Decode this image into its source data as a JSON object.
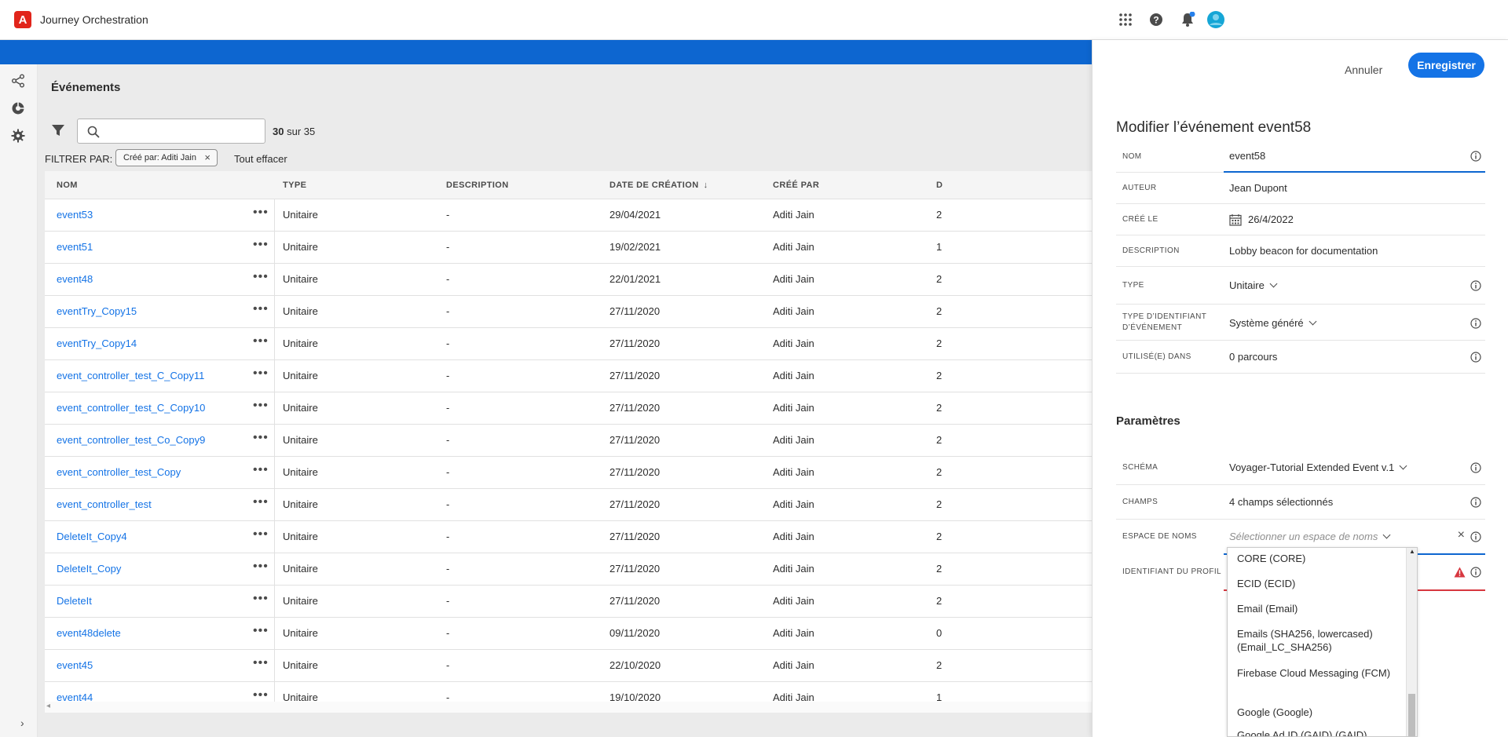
{
  "app": {
    "logo_text": "A",
    "title": "Journey Orchestration",
    "notification_count": ""
  },
  "events_list": {
    "title": "Événements",
    "search_placeholder": "",
    "count_shown": "30",
    "count_suffix": "sur 35",
    "filter_label": "FILTRER PAR:",
    "filter_chip": "Créé par: Aditi Jain",
    "clear_all": "Tout effacer",
    "columns": [
      "NOM",
      "TYPE",
      "DESCRIPTION",
      "DATE DE CRÉATION",
      "CRÉÉ PAR",
      "D"
    ],
    "rows": [
      {
        "name": "event53",
        "type": "Unitaire",
        "description": "-",
        "date": "29/04/2021",
        "creator": "Aditi Jain",
        "extra": "2"
      },
      {
        "name": "event51",
        "type": "Unitaire",
        "description": "-",
        "date": "19/02/2021",
        "creator": "Aditi Jain",
        "extra": "1"
      },
      {
        "name": "event48",
        "type": "Unitaire",
        "description": "-",
        "date": "22/01/2021",
        "creator": "Aditi Jain",
        "extra": "2"
      },
      {
        "name": "eventTry_Copy15",
        "type": "Unitaire",
        "description": "-",
        "date": "27/11/2020",
        "creator": "Aditi Jain",
        "extra": "2"
      },
      {
        "name": "eventTry_Copy14",
        "type": "Unitaire",
        "description": "-",
        "date": "27/11/2020",
        "creator": "Aditi Jain",
        "extra": "2"
      },
      {
        "name": "event_controller_test_C_Copy11",
        "type": "Unitaire",
        "description": "-",
        "date": "27/11/2020",
        "creator": "Aditi Jain",
        "extra": "2"
      },
      {
        "name": "event_controller_test_C_Copy10",
        "type": "Unitaire",
        "description": "-",
        "date": "27/11/2020",
        "creator": "Aditi Jain",
        "extra": "2"
      },
      {
        "name": "event_controller_test_Co_Copy9",
        "type": "Unitaire",
        "description": "-",
        "date": "27/11/2020",
        "creator": "Aditi Jain",
        "extra": "2"
      },
      {
        "name": "event_controller_test_Copy",
        "type": "Unitaire",
        "description": "-",
        "date": "27/11/2020",
        "creator": "Aditi Jain",
        "extra": "2"
      },
      {
        "name": "event_controller_test",
        "type": "Unitaire",
        "description": "-",
        "date": "27/11/2020",
        "creator": "Aditi Jain",
        "extra": "2"
      },
      {
        "name": "DeleteIt_Copy4",
        "type": "Unitaire",
        "description": "-",
        "date": "27/11/2020",
        "creator": "Aditi Jain",
        "extra": "2"
      },
      {
        "name": "DeleteIt_Copy",
        "type": "Unitaire",
        "description": "-",
        "date": "27/11/2020",
        "creator": "Aditi Jain",
        "extra": "2"
      },
      {
        "name": "DeleteIt",
        "type": "Unitaire",
        "description": "-",
        "date": "27/11/2020",
        "creator": "Aditi Jain",
        "extra": "2"
      },
      {
        "name": "event48delete",
        "type": "Unitaire",
        "description": "-",
        "date": "09/11/2020",
        "creator": "Aditi Jain",
        "extra": "0"
      },
      {
        "name": "event45",
        "type": "Unitaire",
        "description": "-",
        "date": "22/10/2020",
        "creator": "Aditi Jain",
        "extra": "2"
      },
      {
        "name": "event44",
        "type": "Unitaire",
        "description": "-",
        "date": "19/10/2020",
        "creator": "Aditi Jain",
        "extra": "1"
      }
    ]
  },
  "edit_panel": {
    "cancel_label": "Annuler",
    "save_label": "Enregistrer",
    "title": "Modifier l’événement event58",
    "fields": {
      "name_label": "NOM",
      "name_value": "event58",
      "author_label": "AUTEUR",
      "author_value": "Jean Dupont",
      "created_label": "CRÉÉ LE",
      "created_value": "26/4/2022",
      "description_label": "DESCRIPTION",
      "description_value": "Lobby beacon for documentation",
      "type_label": "TYPE",
      "type_value": "Unitaire",
      "id_type_label_1": "TYPE D’IDENTIFIANT",
      "id_type_label_2": "D’ÉVÉNEMENT",
      "id_type_value": "Système généré",
      "used_in_label": "UTILISÉ(E) DANS",
      "used_in_value": "0 parcours"
    },
    "parameters_title": "Paramètres",
    "params": {
      "schema_label": "SCHÉMA",
      "schema_value": "Voyager-Tutorial Extended Event v.1",
      "fields_label": "CHAMPS",
      "fields_value": "4 champs sélectionnés",
      "namespace_label": "ESPACE DE NOMS",
      "namespace_placeholder": "Sélectionner un espace de noms",
      "profile_id_label": "IDENTIFIANT DU PROFIL"
    },
    "namespace_options": [
      "CORE (CORE)",
      "ECID (ECID)",
      "Email (Email)",
      "Emails (SHA256, lowercased) (Email_LC_SHA256)",
      "Firebase Cloud Messaging (FCM)",
      "Google (Google)",
      "Google Ad ID (GAID) (GAID)"
    ]
  },
  "colors": {
    "accent": "#1473e6",
    "band": "#0d66d0",
    "error": "#d7373f",
    "logo": "#e1251b"
  }
}
